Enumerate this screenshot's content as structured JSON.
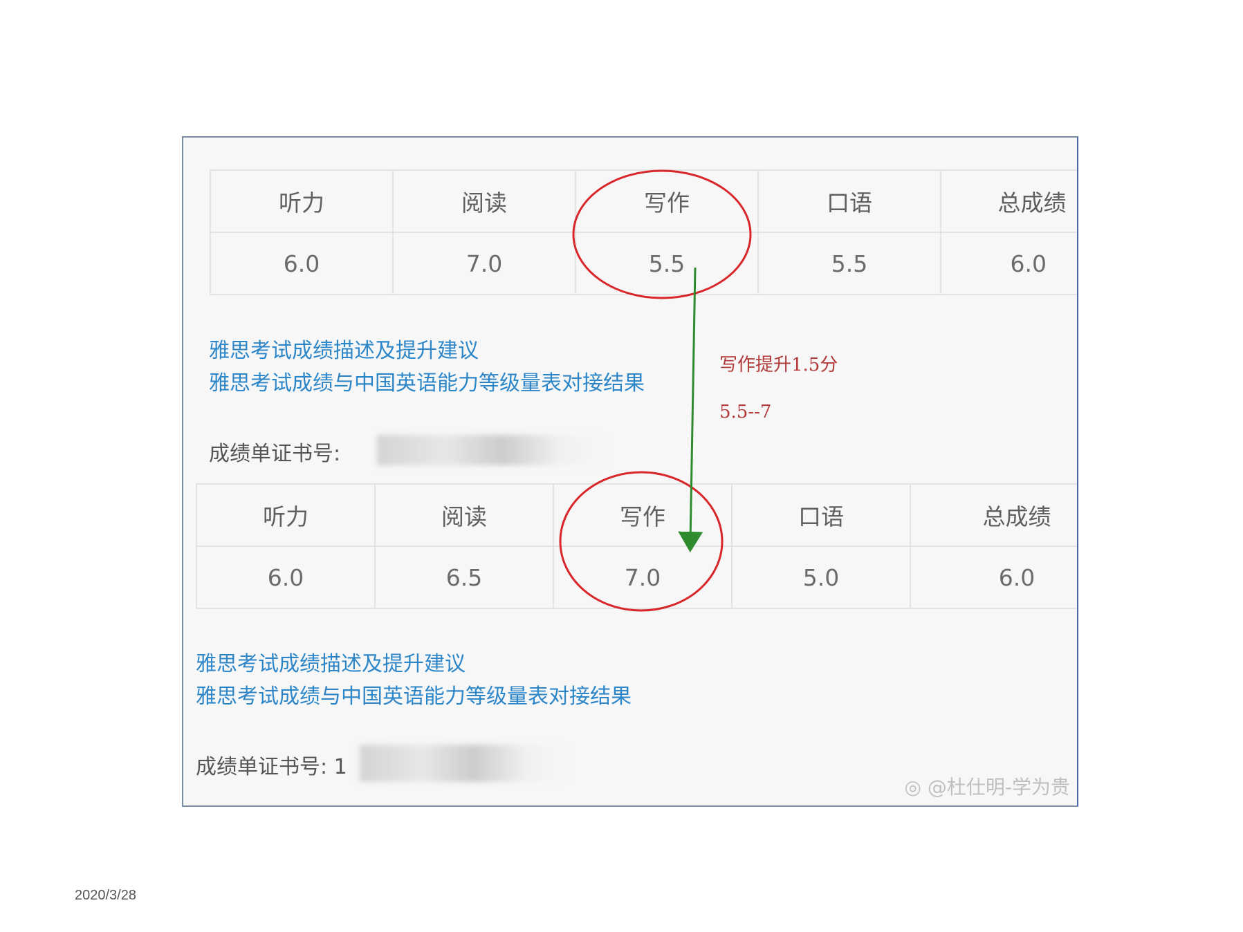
{
  "report_before": {
    "headers": [
      "听力",
      "阅读",
      "写作",
      "口语",
      "总成绩"
    ],
    "scores": [
      "6.0",
      "7.0",
      "5.5",
      "5.5",
      "6.0"
    ],
    "link_description": "雅思考试成绩描述及提升建议",
    "link_cse": "雅思考试成绩与中国英语能力等级量表对接结果",
    "certificate_label": "成绩单证书号:"
  },
  "report_after": {
    "headers": [
      "听力",
      "阅读",
      "写作",
      "口语",
      "总成绩"
    ],
    "scores": [
      "6.0",
      "6.5",
      "7.0",
      "5.0",
      "6.0"
    ],
    "link_description": "雅思考试成绩描述及提升建议",
    "link_cse": "雅思考试成绩与中国英语能力等级量表对接结果",
    "certificate_label": "成绩单证书号: 1"
  },
  "annotation": {
    "text": "写作提升1.5分",
    "range": "5.5--7",
    "circle_color": "#d8262a",
    "arrow_color": "#2e8b2e"
  },
  "watermark": "@杜仕明-学为贵",
  "footer": {
    "date": "2020/3/28"
  }
}
